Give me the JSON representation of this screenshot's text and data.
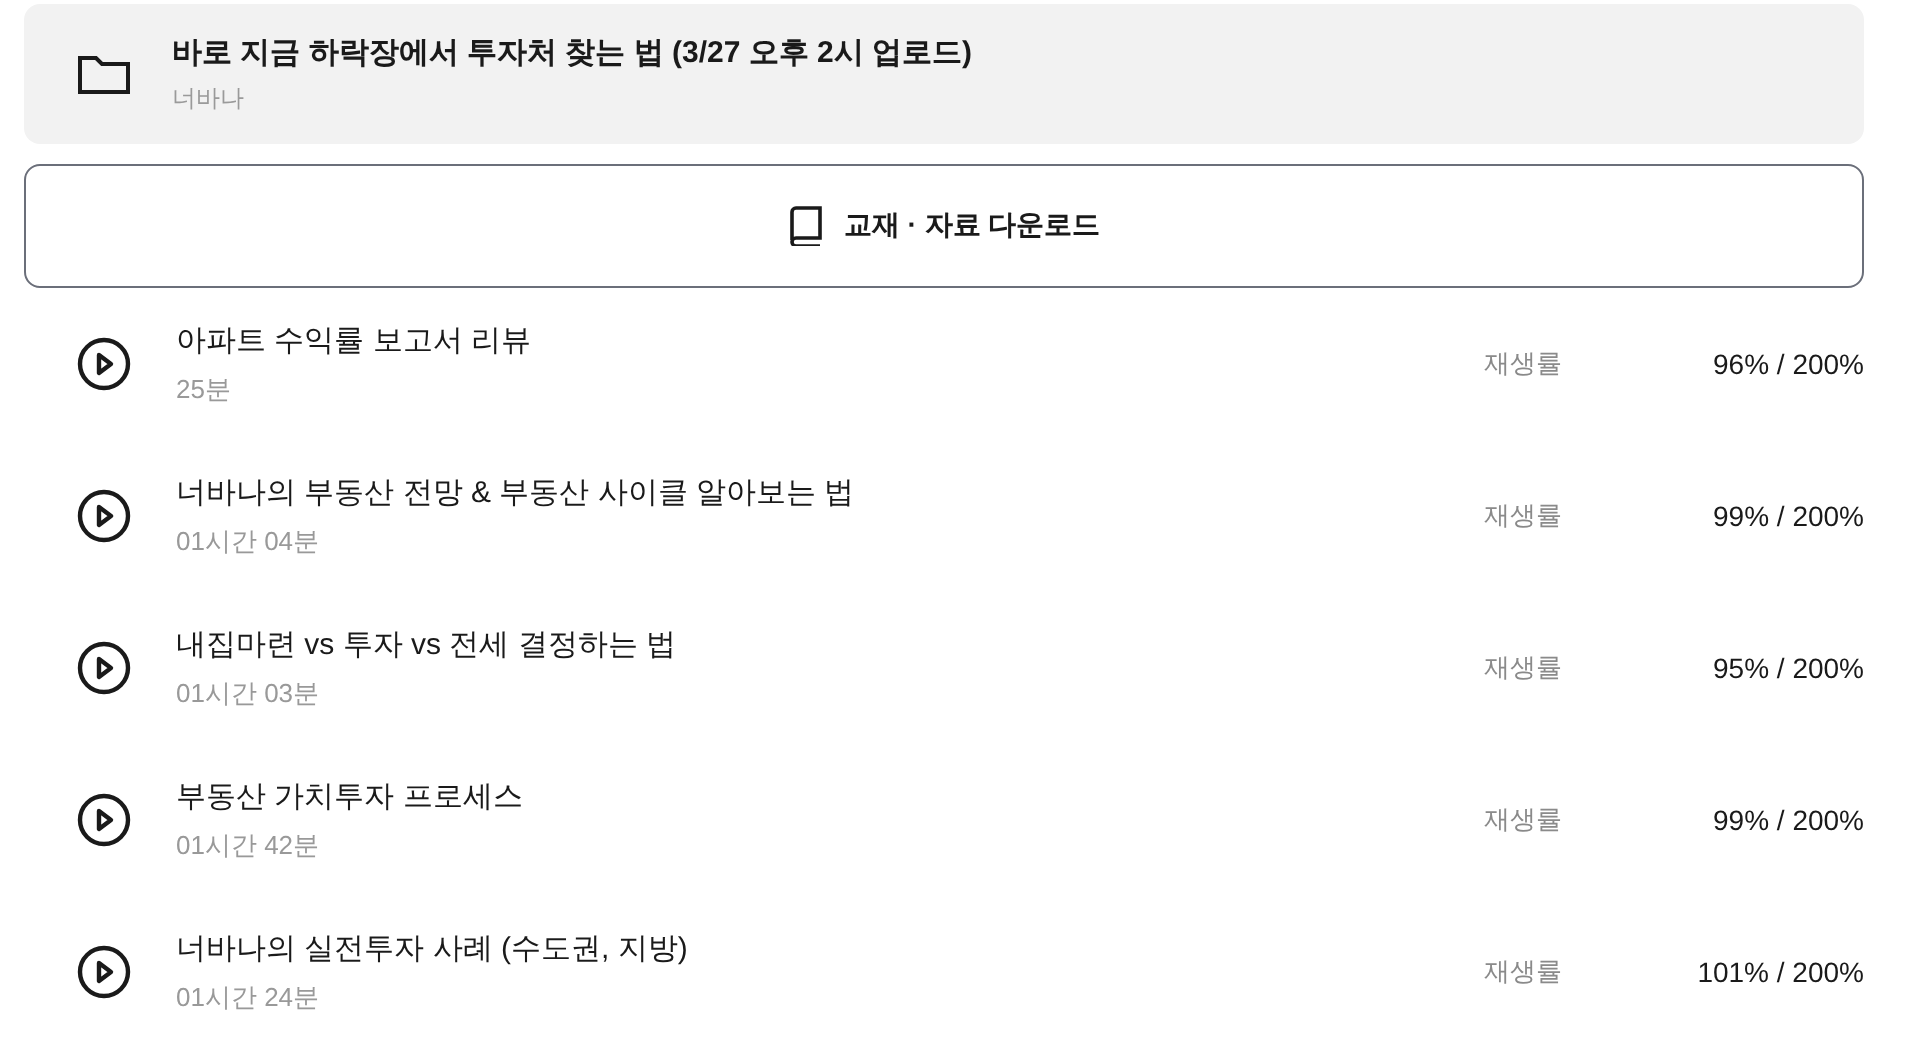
{
  "course": {
    "title": "바로 지금 하락장에서 투자처 찾는 법 (3/27 오후 2시 업로드)",
    "author": "너바나"
  },
  "download_button": {
    "label": "교재 · 자료 다운로드"
  },
  "lessons": [
    {
      "title": "아파트 수익률 보고서 리뷰",
      "duration": "25분",
      "rate_label": "재생률",
      "rate": "96% / 200%"
    },
    {
      "title": "너바나의 부동산 전망 & 부동산 사이클 알아보는 법",
      "duration": "01시간 04분",
      "rate_label": "재생률",
      "rate": "99% / 200%"
    },
    {
      "title": "내집마련 vs 투자 vs 전세 결정하는 법",
      "duration": "01시간 03분",
      "rate_label": "재생률",
      "rate": "95% / 200%"
    },
    {
      "title": "부동산 가치투자 프로세스",
      "duration": "01시간 42분",
      "rate_label": "재생률",
      "rate": "99% / 200%"
    },
    {
      "title": "너바나의 실전투자 사례 (수도권, 지방)",
      "duration": "01시간 24분",
      "rate_label": "재생률",
      "rate": "101% / 200%"
    }
  ]
}
